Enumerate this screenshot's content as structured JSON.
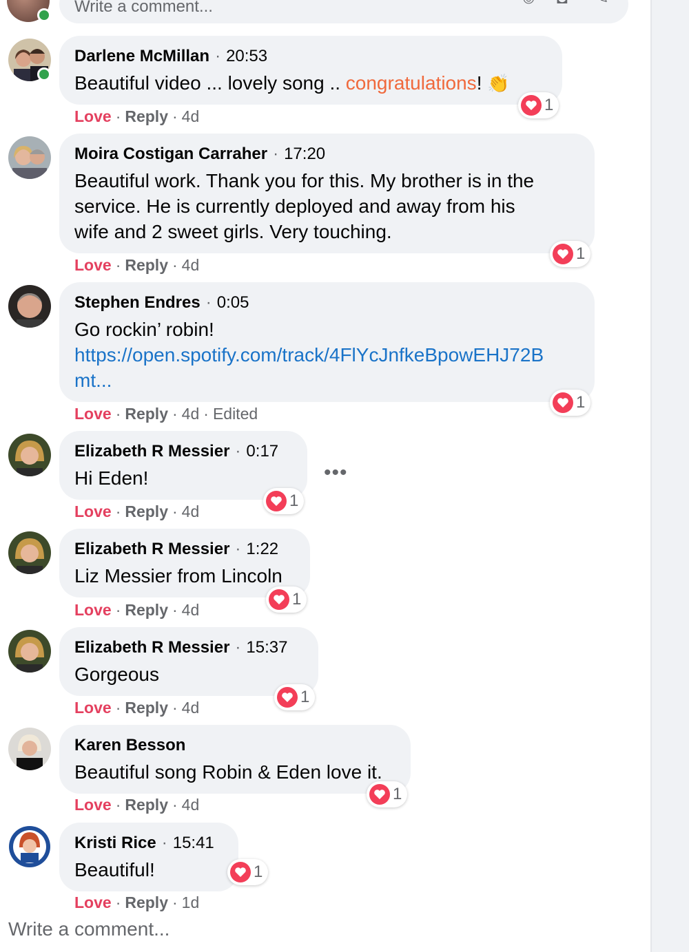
{
  "composer_top": {
    "placeholder": "Write a comment..."
  },
  "comments": [
    {
      "name": "Darlene McMillan",
      "time": "20:53",
      "text_main": "Beautiful video ... lovely song .. ",
      "text_highlight": "congratulations",
      "text_tail": "!",
      "emoji": "👏",
      "love": "Love",
      "reply": "Reply",
      "age": "4d",
      "reactions": "1",
      "online": true
    },
    {
      "name": "Moira Costigan Carraher",
      "time": "17:20",
      "lines": [
        "Beautiful work. Thank you for this. My brother is in the",
        "service. He is currently deployed and away from his",
        "wife and 2 sweet girls. Very touching."
      ],
      "love": "Love",
      "reply": "Reply",
      "age": "4d",
      "reactions": "1"
    },
    {
      "name": "Stephen Endres",
      "time": "0:05",
      "text": "Go rockin’ robin!",
      "link_line1": "https://open.spotify.com/track/4FlYcJnfkeBpowEHJ72B",
      "link_line2": "mt...",
      "love": "Love",
      "reply": "Reply",
      "age": "4d",
      "edited": "Edited",
      "reactions": "1"
    },
    {
      "name": "Elizabeth R Messier",
      "time": "0:17",
      "text": "Hi Eden!",
      "love": "Love",
      "reply": "Reply",
      "age": "4d",
      "reactions": "1"
    },
    {
      "name": "Elizabeth R Messier",
      "time": "1:22",
      "text": "Liz Messier from Lincoln",
      "love": "Love",
      "reply": "Reply",
      "age": "4d",
      "reactions": "1"
    },
    {
      "name": "Elizabeth R Messier",
      "time": "15:37",
      "text": "Gorgeous",
      "love": "Love",
      "reply": "Reply",
      "age": "4d",
      "reactions": "1"
    },
    {
      "name": "Karen Besson",
      "text": "Beautiful song Robin & Eden love it.",
      "love": "Love",
      "reply": "Reply",
      "age": "4d",
      "reactions": "1"
    },
    {
      "name": "Kristi Rice",
      "time": "15:41",
      "text": "Beautiful!",
      "love": "Love",
      "reply": "Reply",
      "age": "1d",
      "reactions": "1"
    }
  ],
  "composer_bottom": {
    "placeholder": "Write a comment..."
  },
  "icons": [
    "emoji-icon",
    "camera-icon",
    "sticker-icon",
    "more-options-icon",
    "heart-reaction-icon"
  ],
  "colors": {
    "love": "#e4405f",
    "link": "#1a73c8",
    "highlight": "#f0693c",
    "bubble": "#f0f2f5",
    "heart": "#f33e58",
    "online": "#31a24c"
  }
}
